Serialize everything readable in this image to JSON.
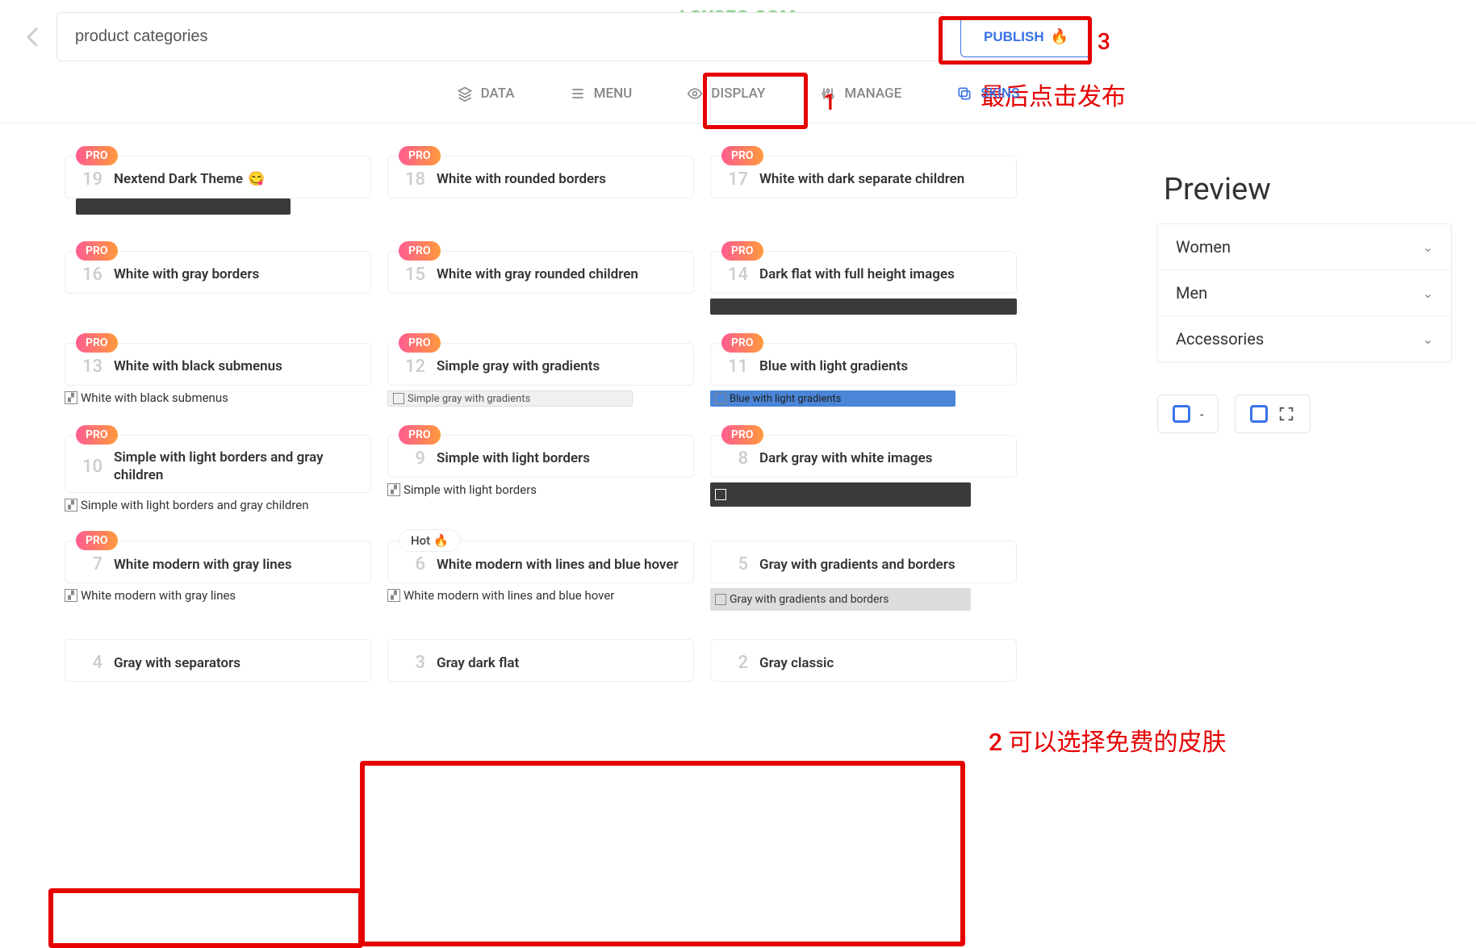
{
  "watermark": "LOYSEO.COM",
  "header": {
    "title_input": "product categories",
    "publish_label": "PUBLISH"
  },
  "annotations": {
    "n1": "1",
    "n2": "2  可以选择免费的皮肤",
    "n3": "3",
    "publish_note": "最后点击发布"
  },
  "tabs": {
    "data": "DATA",
    "menu": "MENU",
    "display": "DISPLAY",
    "manage": "MANAGE",
    "skins": "SKINS"
  },
  "badges": {
    "pro": "PRO",
    "hot": "Hot"
  },
  "skins": [
    {
      "num": "19",
      "name": "Nextend Dark Theme",
      "emoji": "😋",
      "pro": true,
      "preview": "bar-dark-inset"
    },
    {
      "num": "18",
      "name": "White with rounded borders",
      "pro": true
    },
    {
      "num": "17",
      "name": "White with dark separate children",
      "pro": true
    },
    {
      "num": "16",
      "name": "White with gray borders",
      "pro": true
    },
    {
      "num": "15",
      "name": "White with gray rounded children",
      "pro": true
    },
    {
      "num": "14",
      "name": "Dark flat with full height images",
      "pro": true,
      "preview": "bar-dark-full"
    },
    {
      "num": "13",
      "name": "White with black submenus",
      "pro": true,
      "preview": "broken",
      "preview_text": "White with black submenus"
    },
    {
      "num": "12",
      "name": "Simple gray with gradients",
      "pro": true,
      "preview": "gray-bar",
      "preview_text": "Simple gray with gradients"
    },
    {
      "num": "11",
      "name": "Blue with light gradients",
      "pro": true,
      "preview": "blue-bar",
      "preview_text": "Blue with light gradients"
    },
    {
      "num": "10",
      "name": "Simple with light borders and gray children",
      "pro": true,
      "preview": "broken",
      "preview_text": "Simple with light borders and gray children"
    },
    {
      "num": "9",
      "name": "Simple with light borders",
      "pro": true,
      "preview": "broken",
      "preview_text": "Simple with light borders"
    },
    {
      "num": "8",
      "name": "Dark gray with white images",
      "pro": true,
      "preview": "dark-broken"
    },
    {
      "num": "7",
      "name": "White modern with gray lines",
      "pro": true,
      "preview": "broken",
      "preview_text": "White modern with gray lines"
    },
    {
      "num": "6",
      "name": "White modern with lines and blue hover",
      "hot": true,
      "preview": "broken",
      "preview_text": "White modern with lines and blue hover"
    },
    {
      "num": "5",
      "name": "Gray with gradients and borders",
      "preview": "gray2",
      "preview_text": "Gray with gradients and borders"
    },
    {
      "num": "4",
      "name": "Gray with separators"
    },
    {
      "num": "3",
      "name": "Gray dark flat"
    },
    {
      "num": "2",
      "name": "Gray classic"
    }
  ],
  "preview": {
    "title": "Preview",
    "items": [
      "Women",
      "Men",
      "Accessories"
    ],
    "control_label": "-"
  }
}
